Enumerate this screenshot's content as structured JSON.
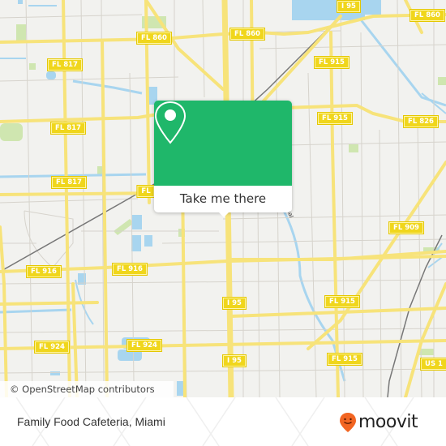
{
  "map": {
    "attribution": "© OpenStreetMap contributors",
    "colors": {
      "land": "#f2f2ef",
      "road_major": "#f7e37a",
      "road_minor": "#d6d3cc",
      "water": "#a8d5ef",
      "park": "#cfe6b0",
      "shield_bg": "#f0d61c"
    },
    "road_labels": [
      {
        "id": "i95-top",
        "text": "I 95"
      },
      {
        "id": "fl860-a",
        "text": "FL 860"
      },
      {
        "id": "fl860-b",
        "text": "FL 860"
      },
      {
        "id": "fl860-c",
        "text": "FL 860"
      },
      {
        "id": "fl817-a",
        "text": "FL 817"
      },
      {
        "id": "fl817-b",
        "text": "FL 817"
      },
      {
        "id": "fl817-c",
        "text": "FL 817"
      },
      {
        "id": "fl915-a",
        "text": "FL 915"
      },
      {
        "id": "fl915-b",
        "text": "FL 915"
      },
      {
        "id": "fl826",
        "text": "FL 826"
      },
      {
        "id": "fl909",
        "text": "FL 909"
      },
      {
        "id": "fl916-a",
        "text": "FL 916"
      },
      {
        "id": "fl916-b",
        "text": "FL 916"
      },
      {
        "id": "i95-mid",
        "text": "I 95"
      },
      {
        "id": "fl915-c",
        "text": "FL 915"
      },
      {
        "id": "fl924-a",
        "text": "FL 924"
      },
      {
        "id": "fl924-b",
        "text": "FL 924"
      },
      {
        "id": "i95-low",
        "text": "I 95"
      },
      {
        "id": "fl915-d",
        "text": "FL 915"
      },
      {
        "id": "us1",
        "text": "US 1"
      },
      {
        "id": "fl-partial",
        "text": "FL"
      }
    ],
    "canal_label": "Canal"
  },
  "popup": {
    "icon": "location-pin-icon",
    "button_label": "Take me there",
    "accent": "#1fb76a"
  },
  "footer": {
    "place_title": "Family Food Cafeteria, Miami",
    "brand": "moovit",
    "brand_color": "#f26522"
  }
}
